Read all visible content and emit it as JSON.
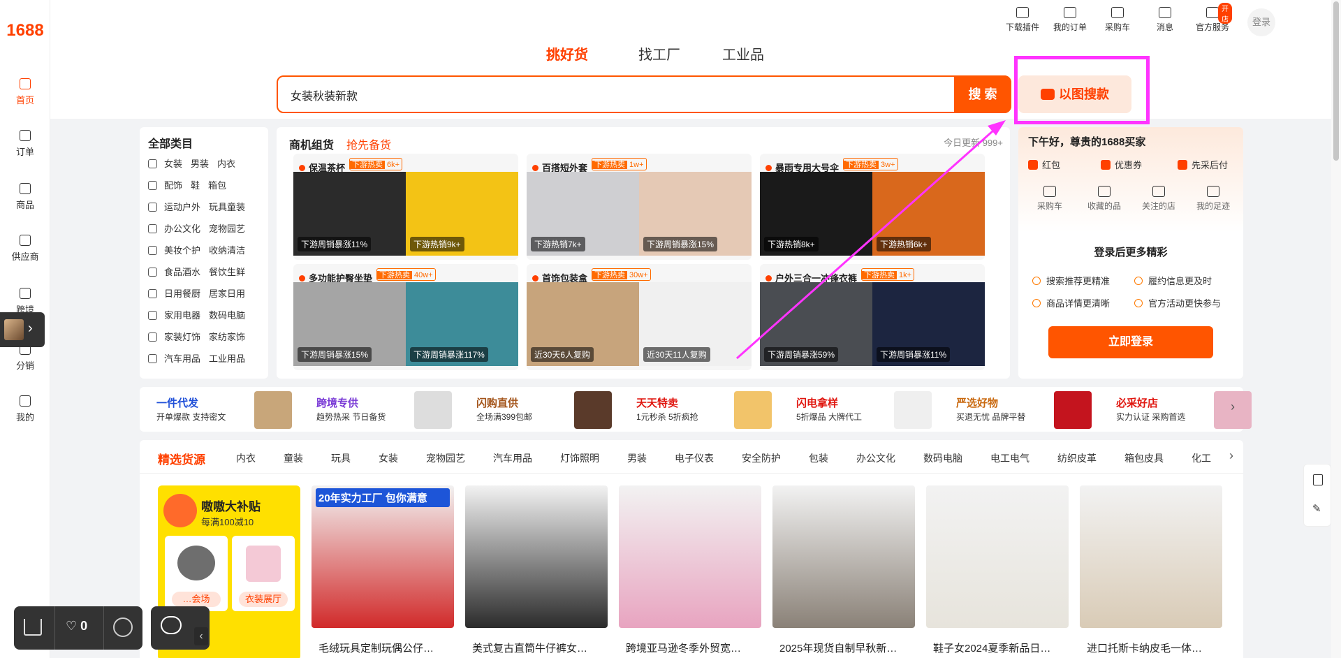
{
  "logo": "1688",
  "leftnav": [
    {
      "label": "首页",
      "icon": "home-icon",
      "active": true
    },
    {
      "label": "订单",
      "icon": "order-icon"
    },
    {
      "label": "商品",
      "icon": "grid-icon"
    },
    {
      "label": "供应商",
      "icon": "supplier-icon"
    },
    {
      "label": "跨境",
      "icon": "globe-icon"
    },
    {
      "label": "分销",
      "icon": "distribute-icon"
    },
    {
      "label": "我的",
      "icon": "user-icon"
    }
  ],
  "topnav": [
    {
      "label": "下载插件",
      "icon": "plugin-icon"
    },
    {
      "label": "我的订单",
      "icon": "clipboard-icon"
    },
    {
      "label": "采购车",
      "icon": "cart-icon"
    },
    {
      "label": "消息",
      "icon": "message-icon"
    },
    {
      "label": "官方服务",
      "icon": "service-icon",
      "badge": "开店"
    }
  ],
  "login_avatar": "登录",
  "tabs": [
    "挑好货",
    "找工厂",
    "工业品"
  ],
  "search": {
    "value": "女装秋装新款",
    "button": "搜 索",
    "image_search": "以图搜款"
  },
  "categories": {
    "title": "全部类目",
    "rows": [
      [
        "女装",
        "男装",
        "内衣"
      ],
      [
        "配饰",
        "鞋",
        "箱包"
      ],
      [
        "运动户外",
        "玩具童装"
      ],
      [
        "办公文化",
        "宠物园艺"
      ],
      [
        "美妆个护",
        "收纳清洁"
      ],
      [
        "食品酒水",
        "餐饮生鲜"
      ],
      [
        "日用餐厨",
        "居家日用"
      ],
      [
        "家用电器",
        "数码电脑"
      ],
      [
        "家装灯饰",
        "家纺家饰"
      ],
      [
        "汽车用品",
        "工业用品"
      ]
    ]
  },
  "products_panel": {
    "title": "商机组货",
    "subtitle": "抢先备货",
    "updated": "今日更新 999+",
    "groups": [
      {
        "name": "保温茶杯",
        "hot_label": "下游热卖",
        "hot_count": "6k+",
        "captions": [
          "下游周销暴涨11%",
          "下游热销9k+"
        ],
        "colors": [
          "#2b2b2b",
          "#f3c315"
        ]
      },
      {
        "name": "百搭短外套",
        "hot_label": "下游热卖",
        "hot_count": "1w+",
        "captions": [
          "下游热销7k+",
          "下游周销暴涨15%"
        ],
        "colors": [
          "#cfcfd2",
          "#e5c9b5"
        ]
      },
      {
        "name": "暴雨专用大号伞",
        "hot_label": "下游热卖",
        "hot_count": "3w+",
        "captions": [
          "下游热销8k+",
          "下游热销6k+"
        ],
        "colors": [
          "#1a1a1a",
          "#d9681c"
        ]
      },
      {
        "name": "多功能护臀坐垫",
        "hot_label": "下游热卖",
        "hot_count": "40w+",
        "captions": [
          "下游周销暴涨15%",
          "下游周销暴涨117%"
        ],
        "colors": [
          "#a5a5a5",
          "#3d8c99"
        ]
      },
      {
        "name": "首饰包装盒",
        "hot_label": "下游热卖",
        "hot_count": "30w+",
        "captions": [
          "近30天6人复购",
          "近30天11人复购"
        ],
        "colors": [
          "#c7a47c",
          "#f0f0f0"
        ]
      },
      {
        "name": "户外三合一冲锋衣裤",
        "hot_label": "下游热卖",
        "hot_count": "1k+",
        "captions": [
          "下游周销暴涨59%",
          "下游周销暴涨11%"
        ],
        "colors": [
          "#4a4d52",
          "#1c2540"
        ]
      }
    ]
  },
  "user_panel": {
    "greeting": "下午好，尊贵的1688买家",
    "perks": [
      "红包",
      "优惠券",
      "先采后付"
    ],
    "shortcuts": [
      {
        "label": "采购车",
        "icon": "cart-icon"
      },
      {
        "label": "收藏的品",
        "icon": "star-icon"
      },
      {
        "label": "关注的店",
        "icon": "shop-icon"
      },
      {
        "label": "我的足迹",
        "icon": "footprint-icon"
      }
    ],
    "more_title": "登录后更多精彩",
    "benefits": [
      "搜索推荐更精准",
      "履约信息更及时",
      "商品详情更清晰",
      "官方活动更快参与"
    ],
    "login_button": "立即登录"
  },
  "channels": [
    {
      "title": "一件代发",
      "sub": "开单爆款 支持密文",
      "color": "#1f4fd8",
      "img": "#c8a67a"
    },
    {
      "title": "跨境专供",
      "sub": "趋势热采 节日备货",
      "color": "#7a3bd6",
      "img": "#dddddd"
    },
    {
      "title": "闪购直供",
      "sub": "全场满399包邮",
      "color": "#a3541a",
      "img": "#5a3a2a"
    },
    {
      "title": "天天特卖",
      "sub": "1元秒杀 5折疯抢",
      "color": "#e0160f",
      "img": "#f2c46a"
    },
    {
      "title": "闪电拿样",
      "sub": "5折爆品 大牌代工",
      "color": "#e0160f",
      "img": "#efefef"
    },
    {
      "title": "严选好物",
      "sub": "买退无忧 品牌平替",
      "color": "#c9690f",
      "img": "#c4141e"
    },
    {
      "title": "必采好店",
      "sub": "实力认证 采购首选",
      "color": "#e0160f",
      "img": "#e8b4c4"
    }
  ],
  "featured": {
    "title": "精选货源",
    "tabs": [
      "内衣",
      "童装",
      "玩具",
      "女装",
      "宠物园艺",
      "汽车用品",
      "灯饰照明",
      "男装",
      "电子仪表",
      "安全防护",
      "包装",
      "办公文化",
      "数码电脑",
      "电工电气",
      "纺织皮革",
      "箱包皮具",
      "化工"
    ],
    "promo": {
      "title": "嗷嗷大补贴",
      "sub": "每满100减10",
      "labels": [
        "…会场",
        "衣装展厅"
      ]
    },
    "items": [
      {
        "name": "毛绒玩具定制玩偶公仔…",
        "color": "#d12a2a",
        "banner": "20年实力工厂 包你满意"
      },
      {
        "name": "美式复古直筒牛仔裤女…",
        "color": "#2b2b2b",
        "banner": ""
      },
      {
        "name": "跨境亚马逊冬季外贸宽…",
        "color": "#e8a4c0",
        "banner": ""
      },
      {
        "name": "2025年现货自制早秋新…",
        "color": "#8a8177",
        "banner": ""
      },
      {
        "name": "鞋子女2024夏季新品日…",
        "color": "#e7e4dc",
        "banner": ""
      },
      {
        "name": "进口托斯卡纳皮毛一体…",
        "color": "#d9cbb6",
        "banner": ""
      }
    ]
  },
  "bottom_bar": {
    "favorites": "0"
  }
}
